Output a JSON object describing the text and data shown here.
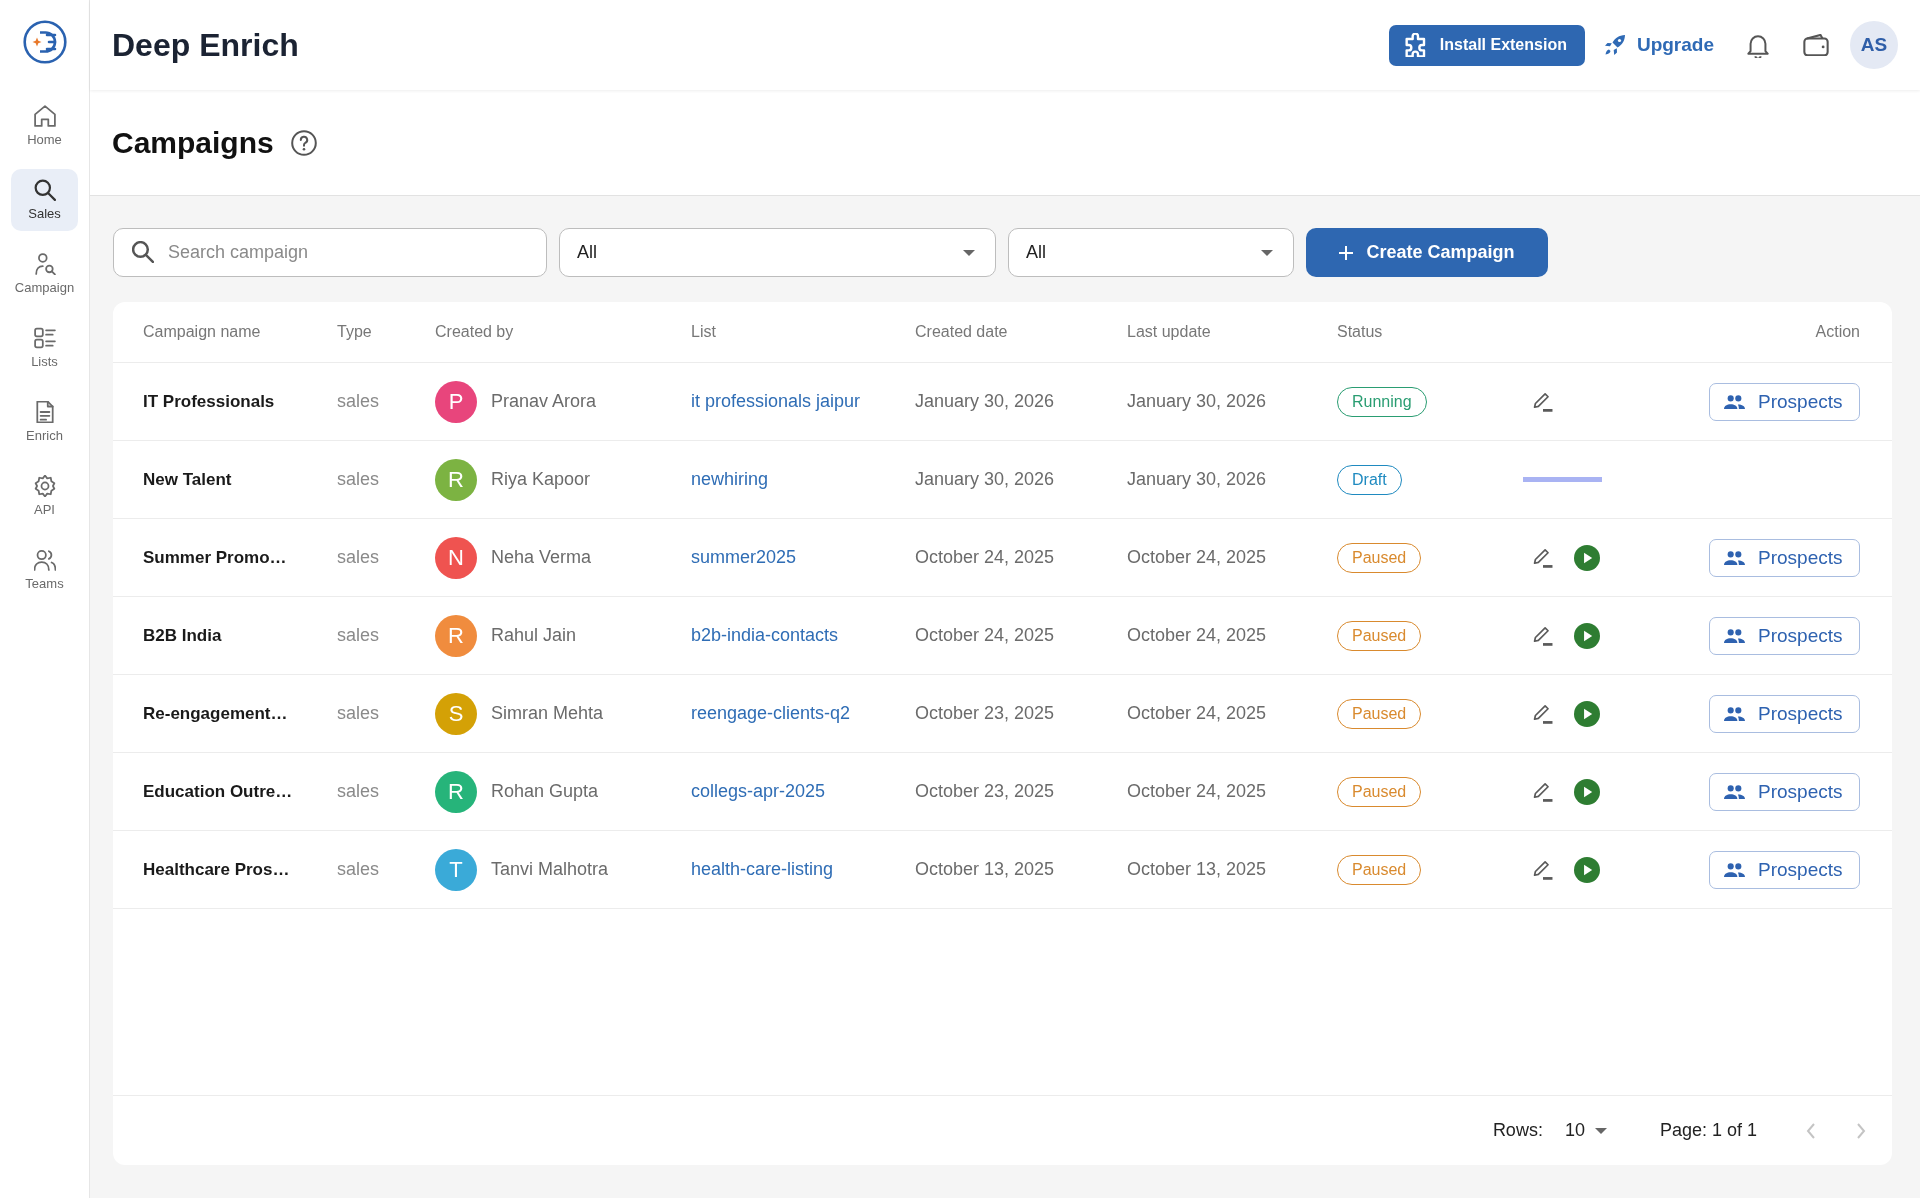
{
  "sidebar": {
    "items": [
      {
        "label": "Home",
        "selected": false
      },
      {
        "label": "Sales",
        "selected": true
      },
      {
        "label": "Campaign",
        "selected": false
      },
      {
        "label": "Lists",
        "selected": false
      },
      {
        "label": "Enrich",
        "selected": false
      },
      {
        "label": "API",
        "selected": false
      },
      {
        "label": "Teams",
        "selected": false
      }
    ]
  },
  "header": {
    "title": "Deep Enrich",
    "install_button": "Install Extension",
    "upgrade_link": "Upgrade",
    "avatar": "AS"
  },
  "page": {
    "title": "Campaigns"
  },
  "toolbar": {
    "search": {
      "placeholder": "Search campaign"
    },
    "filters": [
      {
        "value": "All"
      },
      {
        "value": "All"
      }
    ],
    "create_button": "Create Campaign"
  },
  "table": {
    "columns": [
      "Campaign name",
      "Type",
      "Created by",
      "List",
      "Created date",
      "Last update",
      "Status",
      "Action"
    ],
    "rows": [
      {
        "name": "IT Professionals",
        "type": "sales",
        "creator": {
          "initial": "P",
          "name": "Pranav Arora",
          "color": "#e8457c"
        },
        "list": "it professionals jaipur",
        "created": "January 30, 2026",
        "updated": "January 30, 2026",
        "status": {
          "label": "Running",
          "color": "#2a9d72"
        },
        "actions": [
          {
            "kind": "edit"
          }
        ],
        "action": "Prospects"
      },
      {
        "name": "New Talent",
        "type": "sales",
        "creator": {
          "initial": "R",
          "name": "Riya Kapoor",
          "color": "#7cb342"
        },
        "list": "newhiring",
        "created": "January 30, 2026",
        "updated": "January 30, 2026",
        "status": {
          "label": "Draft",
          "color": "#1f8ac0"
        },
        "actions": [
          {
            "kind": "loading"
          }
        ]
      },
      {
        "name": "Summer Promo…",
        "type": "sales",
        "creator": {
          "initial": "N",
          "name": "Neha Verma",
          "color": "#ef5350"
        },
        "list": "summer2025",
        "created": "October 24, 2025",
        "updated": "October 24, 2025",
        "status": {
          "label": "Paused",
          "color": "#d98a2e"
        },
        "actions": [
          {
            "kind": "edit"
          },
          {
            "kind": "play"
          }
        ],
        "action": "Prospects"
      },
      {
        "name": "B2B India",
        "type": "sales",
        "creator": {
          "initial": "R",
          "name": "Rahul Jain",
          "color": "#f08c3e"
        },
        "list": "b2b-india-contacts",
        "created": "October 24, 2025",
        "updated": "October 24, 2025",
        "status": {
          "label": "Paused",
          "color": "#d98a2e"
        },
        "actions": [
          {
            "kind": "edit"
          },
          {
            "kind": "play"
          }
        ],
        "action": "Prospects"
      },
      {
        "name": "Re-engagement…",
        "type": "sales",
        "creator": {
          "initial": "S",
          "name": "Simran Mehta",
          "color": "#d4a106"
        },
        "list": "reengage-clients-q2",
        "created": "October 23, 2025",
        "updated": "October 24, 2025",
        "status": {
          "label": "Paused",
          "color": "#d98a2e"
        },
        "actions": [
          {
            "kind": "edit"
          },
          {
            "kind": "play"
          }
        ],
        "action": "Prospects"
      },
      {
        "name": "Education Outre…",
        "type": "sales",
        "creator": {
          "initial": "R",
          "name": "Rohan Gupta",
          "color": "#26b47a"
        },
        "list": "collegs-apr-2025",
        "created": "October 23, 2025",
        "updated": "October 24, 2025",
        "status": {
          "label": "Paused",
          "color": "#d98a2e"
        },
        "actions": [
          {
            "kind": "edit"
          },
          {
            "kind": "play"
          }
        ],
        "action": "Prospects"
      },
      {
        "name": "Healthcare Pros…",
        "type": "sales",
        "creator": {
          "initial": "T",
          "name": "Tanvi Malhotra",
          "color": "#3aaad8"
        },
        "list": "health-care-listing",
        "created": "October 13, 2025",
        "updated": "October 13, 2025",
        "status": {
          "label": "Paused",
          "color": "#d98a2e"
        },
        "actions": [
          {
            "kind": "edit"
          },
          {
            "kind": "play"
          }
        ],
        "action": "Prospects"
      }
    ]
  },
  "pagination": {
    "rows_label": "Rows:",
    "rows_value": "10",
    "page": "Page: 1 of 1",
    "prev": {
      "disabled": true
    },
    "next": {
      "disabled": true
    }
  }
}
